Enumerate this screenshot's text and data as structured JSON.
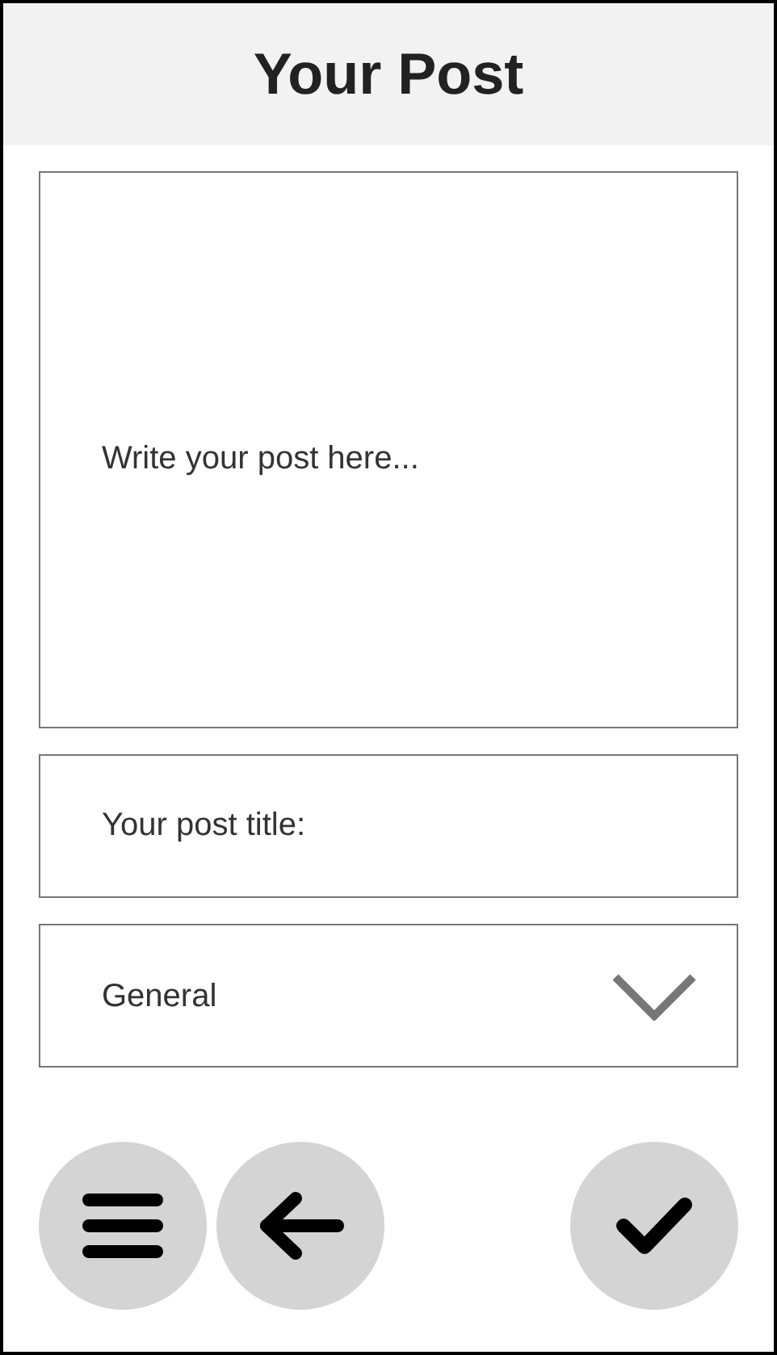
{
  "header": {
    "title": "Your Post"
  },
  "post_field": {
    "placeholder": "Write your post here..."
  },
  "title_field": {
    "placeholder": "Your post title:"
  },
  "category_select": {
    "value": "General"
  },
  "buttons": [
    {
      "kind": "menu"
    },
    {
      "kind": "back"
    },
    {
      "kind": "confirm"
    }
  ]
}
